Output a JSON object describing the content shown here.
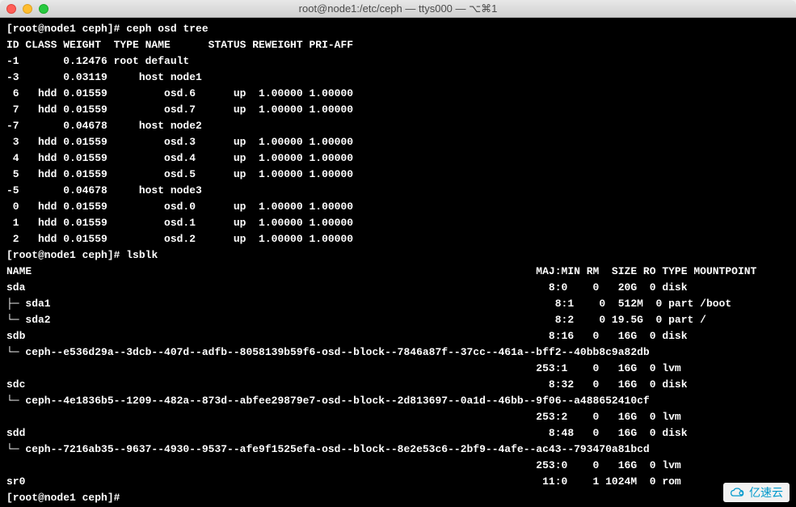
{
  "window": {
    "title": "root@node1:/etc/ceph — ttys000 — ⌥⌘1"
  },
  "terminal": {
    "prompt1": "[root@node1 ceph]# ",
    "cmd1": "ceph osd tree",
    "tree_header": "ID CLASS WEIGHT  TYPE NAME      STATUS REWEIGHT PRI-AFF ",
    "tree_rows": [
      "-1       0.12476 root default                            ",
      "-3       0.03119     host node1                          ",
      " 6   hdd 0.01559         osd.6      up  1.00000 1.00000 ",
      " 7   hdd 0.01559         osd.7      up  1.00000 1.00000 ",
      "-7       0.04678     host node2                          ",
      " 3   hdd 0.01559         osd.3      up  1.00000 1.00000 ",
      " 4   hdd 0.01559         osd.4      up  1.00000 1.00000 ",
      " 5   hdd 0.01559         osd.5      up  1.00000 1.00000 ",
      "-5       0.04678     host node3                          ",
      " 0   hdd 0.01559         osd.0      up  1.00000 1.00000 ",
      " 1   hdd 0.01559         osd.1      up  1.00000 1.00000 ",
      " 2   hdd 0.01559         osd.2      up  1.00000 1.00000 "
    ],
    "prompt2": "[root@node1 ceph]# ",
    "cmd2": "lsblk",
    "lsblk_header": "NAME                                                                                MAJ:MIN RM  SIZE RO TYPE MOUNTPOINT",
    "lsblk_rows": [
      "sda                                                                                   8:0    0   20G  0 disk ",
      "├─ sda1                                                                                8:1    0  512M  0 part /boot",
      "└─ sda2                                                                                8:2    0 19.5G  0 part /",
      "sdb                                                                                   8:16   0   16G  0 disk ",
      "└─ ceph--e536d29a--3dcb--407d--adfb--8058139b59f6-osd--block--7846a87f--37cc--461a--bff2--40bb8c9a82db",
      "                                                                                    253:1    0   16G  0 lvm  ",
      "sdc                                                                                   8:32   0   16G  0 disk ",
      "└─ ceph--4e1836b5--1209--482a--873d--abfee29879e7-osd--block--2d813697--0a1d--46bb--9f06--a488652410cf",
      "                                                                                    253:2    0   16G  0 lvm  ",
      "sdd                                                                                   8:48   0   16G  0 disk ",
      "└─ ceph--7216ab35--9637--4930--9537--afe9f1525efa-osd--block--8e2e53c6--2bf9--4afe--ac43--793470a81bcd",
      "                                                                                    253:0    0   16G  0 lvm  ",
      "sr0                                                                                  11:0    1 1024M  0 rom  "
    ],
    "prompt3": "[root@node1 ceph]# "
  },
  "watermark": {
    "text": "亿速云"
  }
}
